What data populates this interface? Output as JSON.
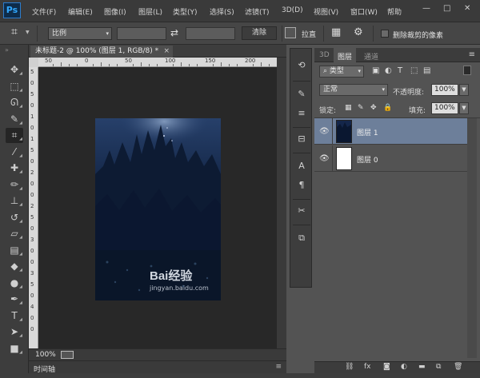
{
  "app": {
    "logo": "Ps"
  },
  "menu": [
    "文件(F)",
    "编辑(E)",
    "图像(I)",
    "图层(L)",
    "类型(Y)",
    "选择(S)",
    "滤镜(T)",
    "3D(D)",
    "视图(V)",
    "窗口(W)",
    "帮助"
  ],
  "window_controls": {
    "minimize": "—",
    "maximize": "□",
    "close": "✕"
  },
  "options_bar": {
    "ratio_select": "比例",
    "swap_symbol": "⇄",
    "clear_button": "清除",
    "straighten_label": "拉直",
    "delete_cropped_label": "删除裁剪的像素"
  },
  "toolbar": {
    "tools": [
      {
        "name": "move-tool",
        "glyph": "✥"
      },
      {
        "name": "marquee-tool",
        "glyph": "⬚"
      },
      {
        "name": "lasso-tool",
        "glyph": "ᘏ"
      },
      {
        "name": "quick-select-tool",
        "glyph": "✎"
      },
      {
        "name": "crop-tool",
        "glyph": "⌗",
        "active": true
      },
      {
        "name": "eyedropper-tool",
        "glyph": "⁄"
      },
      {
        "name": "healing-brush-tool",
        "glyph": "✚"
      },
      {
        "name": "brush-tool",
        "glyph": "✏"
      },
      {
        "name": "clone-stamp-tool",
        "glyph": "⊥"
      },
      {
        "name": "history-brush-tool",
        "glyph": "↺"
      },
      {
        "name": "eraser-tool",
        "glyph": "▱"
      },
      {
        "name": "gradient-tool",
        "glyph": "▤"
      },
      {
        "name": "blur-tool",
        "glyph": "◆"
      },
      {
        "name": "dodge-tool",
        "glyph": "●"
      },
      {
        "name": "pen-tool",
        "glyph": "✒"
      },
      {
        "name": "type-tool",
        "glyph": "T"
      },
      {
        "name": "path-selection-tool",
        "glyph": "➤"
      },
      {
        "name": "rectangle-tool",
        "glyph": "■"
      }
    ]
  },
  "document": {
    "tab_title": "未标题-2 @ 100% (图层 1, RGB/8) *",
    "close_symbol": "×",
    "ruler_h": [
      "50",
      "0",
      "50",
      "100",
      "150",
      "200",
      "250",
      "300",
      "350"
    ],
    "ruler_v": [
      "5",
      "0",
      "5",
      "0",
      "1",
      "0",
      "1",
      "5",
      "0",
      "2",
      "0",
      "0",
      "2",
      "5",
      "0",
      "3",
      "0",
      "0",
      "3",
      "5",
      "0",
      "4",
      "0",
      "0"
    ],
    "zoom": "100%",
    "watermark_main": "Bai经验",
    "watermark_sub": "jingyan.baidu.com"
  },
  "timeline": {
    "label": "时间轴"
  },
  "panel": {
    "tabs": [
      "3D",
      "图层",
      "通道"
    ],
    "active_tab": "图层",
    "filter_type": "类型",
    "blend_mode": "正常",
    "opacity_label": "不透明度:",
    "opacity_value": "100%",
    "lock_label": "锁定:",
    "fill_label": "填充:",
    "fill_value": "100%",
    "layers": [
      {
        "name": "图层 1",
        "selected": true
      },
      {
        "name": "图层 0",
        "selected": false
      }
    ],
    "footer_icons": [
      "link-icon",
      "fx-icon",
      "mask-icon",
      "adjustment-icon",
      "group-icon",
      "new-layer-icon",
      "trash-icon"
    ]
  }
}
